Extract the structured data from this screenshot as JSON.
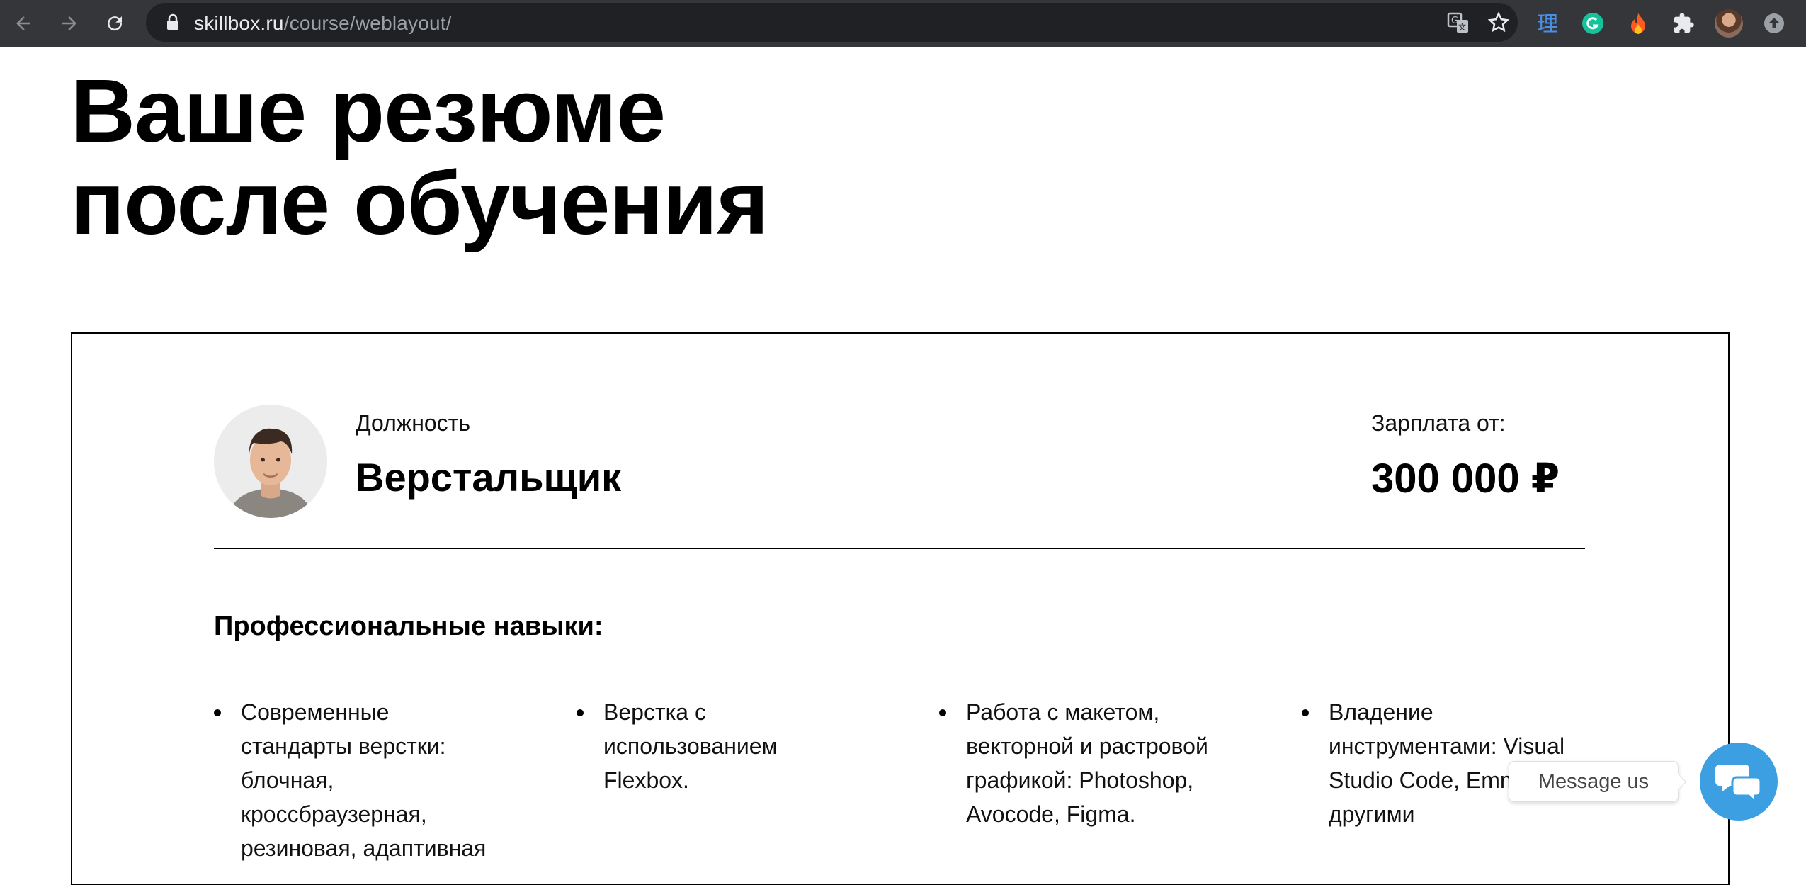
{
  "browser": {
    "url_host": "skillbox.ru",
    "url_path": "/course/weblayout/"
  },
  "page": {
    "title_line1": "Ваше резюме",
    "title_line2": "после обучения"
  },
  "resume": {
    "position_label": "Должность",
    "position_value": "Верстальщик",
    "salary_label": "Зарплата от:",
    "salary_value": "300 000 ₽",
    "skills_heading": "Профессиональные навыки:",
    "skills": [
      "Современные стандарты верстки: блочная, кроссбраузерная, резиновая, адаптивная",
      "Верстка с использованием Flexbox.",
      "Работа с макетом, векторной и растровой графикой: Photoshop, Avocode, Figma.",
      "Владение инструментами: Visual Studio Code, Emmet и другими"
    ]
  },
  "messenger": {
    "label": "Message us"
  },
  "colors": {
    "chrome_bg": "#35363a",
    "omnibox_bg": "#202124",
    "messenger_blue": "#3c9fe1"
  }
}
